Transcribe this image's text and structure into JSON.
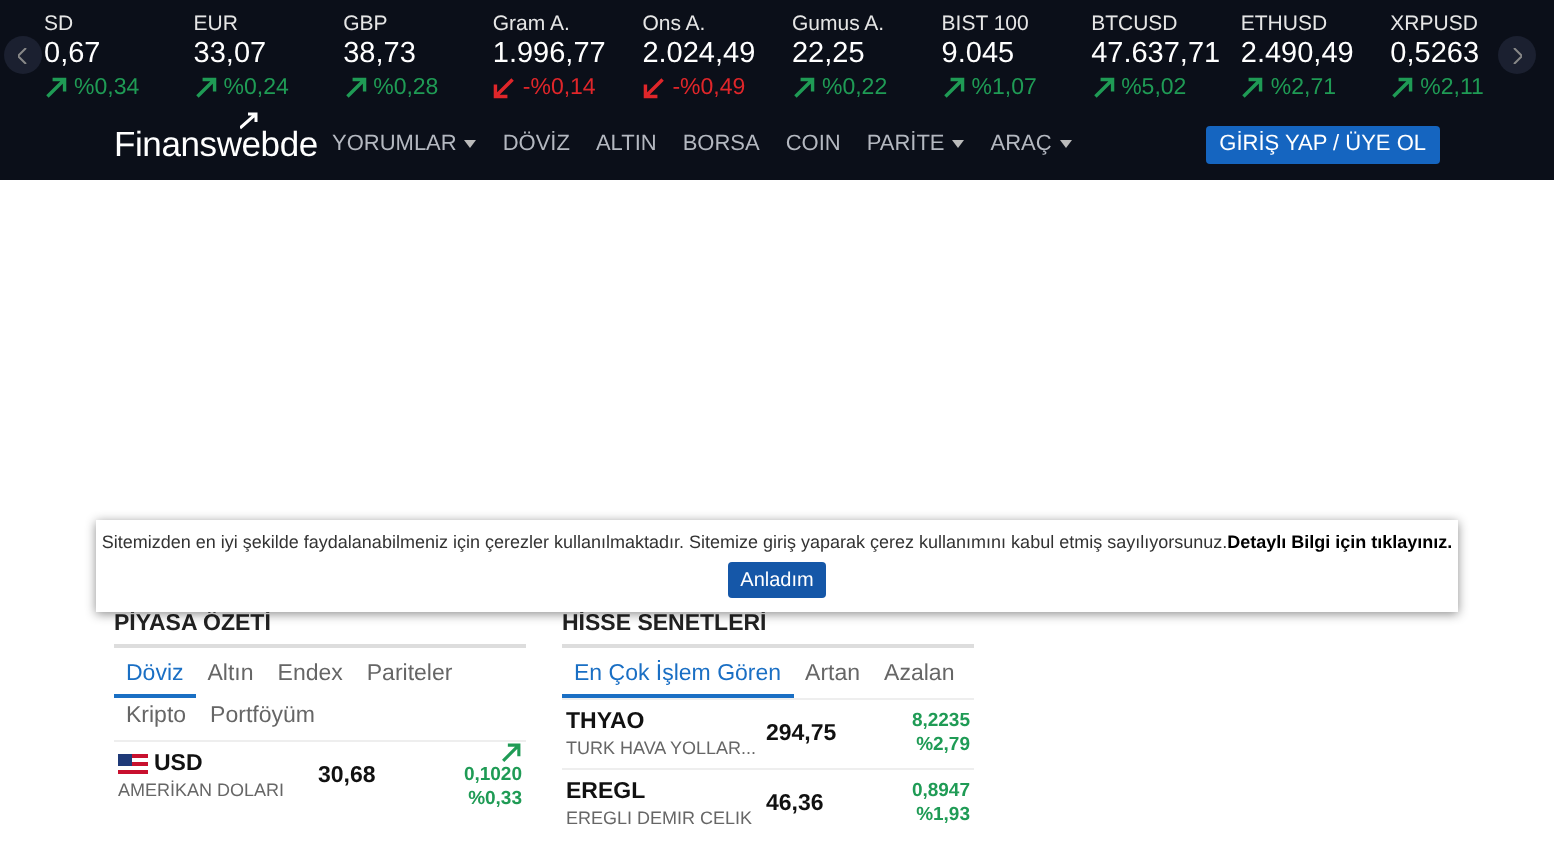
{
  "ticker": [
    {
      "name": "SD",
      "value": "0,67",
      "change": "%0,34",
      "rising": true
    },
    {
      "name": "EUR",
      "value": "33,07",
      "change": "%0,24",
      "rising": true
    },
    {
      "name": "GBP",
      "value": "38,73",
      "change": "%0,28",
      "rising": true
    },
    {
      "name": "Gram A.",
      "value": "1.996,77",
      "change": "-%0,14",
      "rising": false
    },
    {
      "name": "Ons A.",
      "value": "2.024,49",
      "change": "-%0,49",
      "rising": false
    },
    {
      "name": "Gumus A.",
      "value": "22,25",
      "change": "%0,22",
      "rising": true
    },
    {
      "name": "BIST 100",
      "value": "9.045",
      "change": "%1,07",
      "rising": true
    },
    {
      "name": "BTCUSD",
      "value": "47.637,71",
      "change": "%5,02",
      "rising": true
    },
    {
      "name": "ETHUSD",
      "value": "2.490,49",
      "change": "%2,71",
      "rising": true
    },
    {
      "name": "XRPUSD",
      "value": "0,5263",
      "change": "%2,11",
      "rising": true
    }
  ],
  "nav": {
    "logo": "Finanswebde",
    "items": [
      {
        "label": "YORUMLAR",
        "dropdown": true
      },
      {
        "label": "DÖVİZ",
        "dropdown": false
      },
      {
        "label": "ALTIN",
        "dropdown": false
      },
      {
        "label": "BORSA",
        "dropdown": false
      },
      {
        "label": "COIN",
        "dropdown": false
      },
      {
        "label": "PARİTE",
        "dropdown": true
      },
      {
        "label": "ARAÇ",
        "dropdown": true
      }
    ],
    "login_button": "GİRİŞ YAP / ÜYE OL"
  },
  "cookie_banner": {
    "text": "Sitemizden en iyi şekilde faydalanabilmeniz için çerezler kullanılmaktadır. Sitemize giriş yaparak çerez kullanımını kabul etmiş sayılıyorsunuz.",
    "link": "Detaylı Bilgi için tıklayınız.",
    "button": "Anladım"
  },
  "panels": [
    {
      "title": "PİYASA ÖZETİ",
      "tabs": [
        {
          "label": "Döviz",
          "selected": true
        },
        {
          "label": "Altın",
          "selected": false
        },
        {
          "label": "Endex",
          "selected": false
        },
        {
          "label": "Pariteler",
          "selected": false
        },
        {
          "label": "Kripto",
          "selected": false
        },
        {
          "label": "Portföyüm",
          "selected": false
        }
      ],
      "rows": [
        {
          "kind": "currency",
          "code": "USD",
          "name": "AMERİKAN DOLARI",
          "price": "30,68",
          "change": "0,1020",
          "percent": "%0,33",
          "rising": true
        }
      ]
    },
    {
      "title": "HİSSE SENETLERİ",
      "tabs": [
        {
          "label": "En Çok İşlem Gören",
          "selected": true
        },
        {
          "label": "Artan",
          "selected": false
        },
        {
          "label": "Azalan",
          "selected": false
        }
      ],
      "rows": [
        {
          "kind": "stock",
          "code": "THYAO",
          "name": "TURK HAVA YOLLAR...",
          "price": "294,75",
          "change": "8,2235",
          "percent": "%2,79",
          "rising": true
        },
        {
          "kind": "stock",
          "code": "EREGL",
          "name": "EREGLI DEMIR CELIK",
          "price": "46,36",
          "change": "0,8947",
          "percent": "%1,93",
          "rising": true
        }
      ]
    }
  ]
}
